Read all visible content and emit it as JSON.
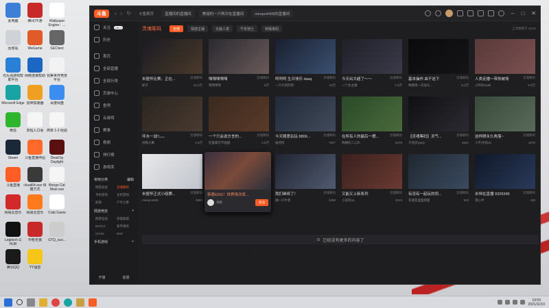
{
  "desktop": {
    "icons": [
      {
        "label": "此电脑",
        "color": "#3d7fd6",
        "col": 0,
        "row": 0
      },
      {
        "label": "腾讯TF游",
        "color": "#c82a2a",
        "col": 1,
        "row": 0
      },
      {
        "label": "Wallpaper Engine：...",
        "color": "#ffffff",
        "col": 2,
        "row": 0
      },
      {
        "label": "回收站",
        "color": "#cfd3d8",
        "col": 0,
        "row": 1
      },
      {
        "label": "WeGame",
        "color": "#e05a2a",
        "col": 1,
        "row": 1
      },
      {
        "label": "SEClient",
        "color": "#666666",
        "col": 2,
        "row": 1
      },
      {
        "label": "光头强游戏帮助平台",
        "color": "#2a7fd6",
        "col": 0,
        "row": 2
      },
      {
        "label": "网络连接帮助",
        "color": "#1c66c4",
        "col": 1,
        "row": 2
      },
      {
        "label": "完美世界竞技平台",
        "color": "#f2f2f2",
        "col": 2,
        "row": 2
      },
      {
        "label": "Microsoft Edge",
        "color": "#1aa3a3",
        "col": 0,
        "row": 3
      },
      {
        "label": "雷神加速器",
        "color": "#f0a020",
        "col": 1,
        "row": 3
      },
      {
        "label": "百度网盘",
        "color": "#3b8ef0",
        "col": 2,
        "row": 3
      },
      {
        "label": "微信",
        "color": "#2db52d",
        "col": 0,
        "row": 4
      },
      {
        "label": "发帖入口看",
        "color": "#f5f5f5",
        "col": 1,
        "row": 4
      },
      {
        "label": "简单 1-2 经验",
        "color": "#f5f5f5",
        "col": 2,
        "row": 4
      },
      {
        "label": "Steam",
        "color": "#1b2838",
        "col": 0,
        "row": 5
      },
      {
        "label": "斗鱼直播伴侣",
        "color": "#ff6a2a",
        "col": 1,
        "row": 5
      },
      {
        "label": "Dead by Daylight",
        "color": "#5a1010",
        "col": 2,
        "row": 5
      },
      {
        "label": "斗鱼直播",
        "color": "#ff5d23",
        "col": 0,
        "row": 6
      },
      {
        "label": "cloud64.exe 快捷方式",
        "color": "#3a3a3a",
        "col": 1,
        "row": 6
      },
      {
        "label": "Bongo Cat Mver.exe",
        "color": "#f5f5f5",
        "col": 2,
        "row": 6
      },
      {
        "label": "网易云音乐",
        "color": "#d22a2a",
        "col": 0,
        "row": 7
      },
      {
        "label": "网易云音乐",
        "color": "#ff7a1a",
        "col": 1,
        "row": 7
      },
      {
        "label": "Crab Game",
        "color": "#ffffff",
        "col": 2,
        "row": 7
      },
      {
        "label": "Logitech G HUB",
        "color": "#111111",
        "col": 0,
        "row": 8
      },
      {
        "label": "中枪无畏",
        "color": "#c82a2a",
        "col": 1,
        "row": 8
      },
      {
        "label": "GTQ_suo...",
        "color": "#cccccc",
        "col": 2,
        "row": 8
      },
      {
        "label": "腾讯QQ",
        "color": "#1a1a1a",
        "col": 0,
        "row": 9
      },
      {
        "label": "YY语音",
        "color": "#f5c518",
        "col": 1,
        "row": 9
      }
    ]
  },
  "app": {
    "logo": "斗鱼",
    "nav_back": "‹",
    "nav_forward": "›",
    "nav_refresh": "↻",
    "tabs": [
      "斗鱼首页",
      "直播间的直播间",
      "美丽的一只再次在直播间",
      "meepo4406的直播间"
    ],
    "icons": [
      "history-icon",
      "search-icon",
      "avatar",
      "message-icon",
      "cart-icon",
      "gift-icon",
      "game-icon",
      "settings-icon"
    ],
    "window_controls": [
      "–",
      "□",
      "✕"
    ]
  },
  "sidebar": {
    "follow_label": "关注",
    "follow_badge": "ON 2",
    "history_label": "历史",
    "items": [
      "首页",
      "全部直播",
      "全部分类",
      "页游中心",
      "鱼吧",
      "云游戏",
      "赛事",
      "视频",
      "排行榜",
      "游戏库"
    ],
    "common_title": "常用分类",
    "common_edit": "编辑",
    "common": [
      "网游竞技",
      "灵魂筹码",
      "手机游戏",
      "主机游戏",
      "颜值",
      "户外之家"
    ],
    "hot_title": "网游竞技",
    "hot": [
      "网游竞技",
      "英雄联盟",
      "DOTA2",
      "和平精英",
      "CFHD",
      "DNF"
    ],
    "mobile_title": "手机游戏",
    "footer_left": "开播",
    "footer_right": "客服"
  },
  "category": {
    "title": "灵魂筹码",
    "tags": [
      "全部",
      "情感主播",
      "无敌人意",
      "千年骑士",
      "特殊筹码"
    ],
    "active_tag": 0,
    "last_update": "上次更新于 19:52"
  },
  "cards": [
    {
      "title": "米娅怀比赛，正在...",
      "cat": "灵魂筹码",
      "host": "妮子",
      "count": "14.2万",
      "colors": [
        "#1a1a22",
        "#4a3a2a"
      ]
    },
    {
      "title": "嘿嘿嘿嘿嘿",
      "cat": "灵魂筹码",
      "host": "嘿嘿嘿嘿",
      "count": "6万",
      "colors": [
        "#2a2a30",
        "#6a5a5a"
      ]
    },
    {
      "title": "呵呵呵 生日快乐 dasq",
      "cat": "灵魂筹码",
      "host": "一只大叔的狗",
      "count": "10万",
      "colors": [
        "#1a2030",
        "#3a5070"
      ]
    },
    {
      "title": "今天出大超了～～",
      "cat": "灵魂筹码",
      "host": "一个女主播",
      "count": "1.9万",
      "colors": [
        "#202028",
        "#3a3a4a"
      ]
    },
    {
      "title": "基本操作 血干这下",
      "cat": "灵魂筹码",
      "host": "明顺第一次加与...",
      "count": "8.2万",
      "colors": [
        "#0a0a0c",
        "#151518"
      ]
    },
    {
      "title": "人类走播～带你被场",
      "cat": "灵魂筹码",
      "host": "小鸡的reptil",
      "count": "5.9万",
      "colors": [
        "#5a3a3a",
        "#7a5050"
      ]
    },
    {
      "title": "坪水一战7。。。",
      "cat": "灵魂筹码",
      "host": "地铁大鹰",
      "count": "2.5万",
      "colors": [
        "#2a2520",
        "#4a3a30"
      ]
    },
    {
      "title": "一个只会说方言的...",
      "cat": "灵魂筹码",
      "host": "吃素最可不能面",
      "count": "1.5万",
      "colors": [
        "#3a2a20",
        "#5a3a28"
      ]
    },
    {
      "title": "今天随意玩玩 8806...",
      "cat": "灵魂筹码",
      "host": "陆月阿",
      "count": "7807",
      "colors": [
        "#202a38",
        "#404a5a"
      ]
    },
    {
      "title": "在所有人的最后一搏...",
      "cat": "灵魂筹码",
      "host": "晓娜的二心叭",
      "count": "6375",
      "colors": [
        "#2a4a2a",
        "#4a6a3a"
      ]
    },
    {
      "title": "【灵魂筹码】灵气...",
      "cat": "灵魂筹码",
      "host": "千语灵QwQ",
      "count": "4841",
      "colors": [
        "#101014",
        "#2a2a30"
      ]
    },
    {
      "title": "这样顾永久角落~",
      "cat": "灵魂筹码",
      "host": "小不点的bm",
      "count": "4676",
      "colors": [
        "#3a4a3a",
        "#5a6a5a"
      ]
    },
    {
      "title": "米娅怀正式小组赛...",
      "cat": "灵魂筹码",
      "host": "meepo4406",
      "count": "3492",
      "colors": [
        "#e8e8ea",
        "#c0c4cc"
      ]
    },
    {
      "title": "恭喜EDG！世界场次双...",
      "cat": "灵魂筹码",
      "host": "洛酥",
      "count": "3091",
      "colors": [
        "#3a2f3f",
        "#7a4a3a"
      ]
    },
    {
      "title": "我们继续了！",
      "cat": "灵魂筹码",
      "host": "嗷一只牛客",
      "count": "1298",
      "colors": [
        "#202430",
        "#505a70"
      ]
    },
    {
      "title": "又能又上新系列",
      "cat": "灵魂筹码",
      "host": "小菜阿sa",
      "count": "1013",
      "colors": [
        "#3a2020",
        "#6a3a30"
      ]
    },
    {
      "title": "有没有一起玩的同...",
      "cat": "灵魂筹码",
      "host": "花城是里面那面",
      "count": "623",
      "colors": [
        "#202830",
        "#3a4a60"
      ]
    },
    {
      "title": "永恒在直播 9329349",
      "cat": "灵魂筹码",
      "host": "凛心中",
      "count": "426",
      "colors": [
        "#101828",
        "#2a3a5a"
      ]
    }
  ],
  "popup": {
    "title": "恭喜EDG！世界场次双...",
    "host": "洛酥",
    "follow": "关注"
  },
  "no_more": "已经没有更多的内容了",
  "taskbar": {
    "time": "19:53",
    "date": "2021/11/10",
    "apps": [
      "win",
      "search",
      "task",
      "file",
      "chrome",
      "edge",
      "explorer",
      "douyu"
    ]
  }
}
